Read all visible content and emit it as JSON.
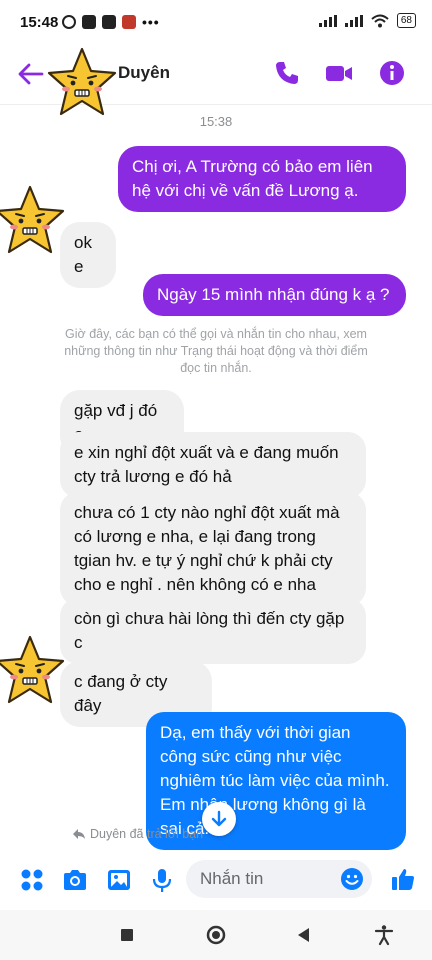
{
  "status_bar": {
    "time": "15:48",
    "dots": "•••",
    "battery": "68"
  },
  "header": {
    "contact_name": "Duyên"
  },
  "chat": {
    "timestamp": "15:38",
    "messages": [
      {
        "text": "Chị ơi, A Trường có bảo em liên hệ với chị về vấn đề Lương ạ."
      },
      {
        "text": "ok e"
      },
      {
        "text": "Ngày 15 mình nhận đúng k ạ ?"
      },
      {
        "text": "gặp vđ j đó e"
      },
      {
        "text": "e xin nghỉ đột xuất và e đang muốn cty trả lương e đó hả"
      },
      {
        "text": "chưa có 1 cty nào nghỉ đột xuất mà có lương e nha, e lại đang trong tgian hv. e tự ý nghỉ chứ k phải cty cho e nghỉ . nên không có e nha"
      },
      {
        "text": "còn gì chưa hài lòng thì đến cty gặp c"
      },
      {
        "text": "c đang ở cty đây"
      },
      {
        "text": "Dạ, em thấy với thời gian công sức cũng như việc nghiêm túc làm việc của mình. Em nhận lương không gì là sai cả."
      }
    ],
    "system_note": "Giờ đây, các bạn có thể gọi và nhắn tin cho nhau, xem những thông tin như Trạng thái hoạt động và thời điểm đọc tin nhắn.",
    "replied_note": "Duyên đã trả lời bạn"
  },
  "composer": {
    "placeholder": "Nhắn tin"
  },
  "colors": {
    "accent": "#8a2be2",
    "bubble_blue": "#0a7cff",
    "incoming": "#f0f0f0",
    "star": "#f7c531"
  }
}
